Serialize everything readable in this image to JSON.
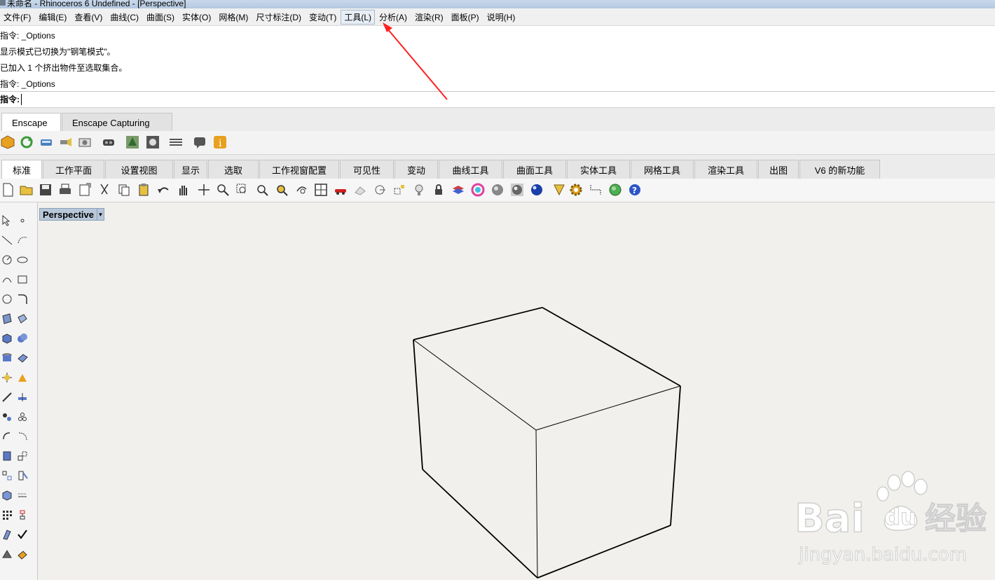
{
  "title_bar": {
    "title": "未命名 - Rhinoceros 6 Undefined - [Perspective]"
  },
  "menu": [
    {
      "label": "文件(F)",
      "active": false
    },
    {
      "label": "编辑(E)",
      "active": false
    },
    {
      "label": "查看(V)",
      "active": false
    },
    {
      "label": "曲线(C)",
      "active": false
    },
    {
      "label": "曲面(S)",
      "active": false
    },
    {
      "label": "实体(O)",
      "active": false
    },
    {
      "label": "网格(M)",
      "active": false
    },
    {
      "label": "尺寸标注(D)",
      "active": false
    },
    {
      "label": "变动(T)",
      "active": false
    },
    {
      "label": "工具(L)",
      "active": true
    },
    {
      "label": "分析(A)",
      "active": false
    },
    {
      "label": "渲染(R)",
      "active": false
    },
    {
      "label": "面板(P)",
      "active": false
    },
    {
      "label": "说明(H)",
      "active": false
    }
  ],
  "command_history": [
    "指令: _Options",
    "显示模式已切换为\"钢笔模式\"。",
    "已加入 1 个挤出物件至选取集合。",
    "指令: _Options"
  ],
  "command_prompt": {
    "label": "指令:",
    "value": ""
  },
  "plugin_tabs": [
    {
      "label": "Enscape",
      "active": true
    },
    {
      "label": "Enscape Capturing",
      "active": false
    }
  ],
  "main_tabs": [
    {
      "label": "标准",
      "active": true
    },
    {
      "label": "工作平面",
      "active": false
    },
    {
      "label": "设置视图",
      "active": false
    },
    {
      "label": "显示",
      "active": false
    },
    {
      "label": "选取",
      "active": false
    },
    {
      "label": "工作视窗配置",
      "active": false
    },
    {
      "label": "可见性",
      "active": false
    },
    {
      "label": "变动",
      "active": false
    },
    {
      "label": "曲线工具",
      "active": false
    },
    {
      "label": "曲面工具",
      "active": false
    },
    {
      "label": "实体工具",
      "active": false
    },
    {
      "label": "网格工具",
      "active": false
    },
    {
      "label": "渲染工具",
      "active": false
    },
    {
      "label": "出图",
      "active": false
    },
    {
      "label": "V6 的新功能",
      "active": false
    }
  ],
  "viewport": {
    "name": "Perspective"
  },
  "watermark": {
    "brand": "Bai du 经验",
    "url": "jingyan.baidu.com"
  },
  "colors": {
    "annotation_arrow": "#ff2020",
    "viewport_bg": "#f1f0ec",
    "label_bg": "#b8c7d9"
  }
}
